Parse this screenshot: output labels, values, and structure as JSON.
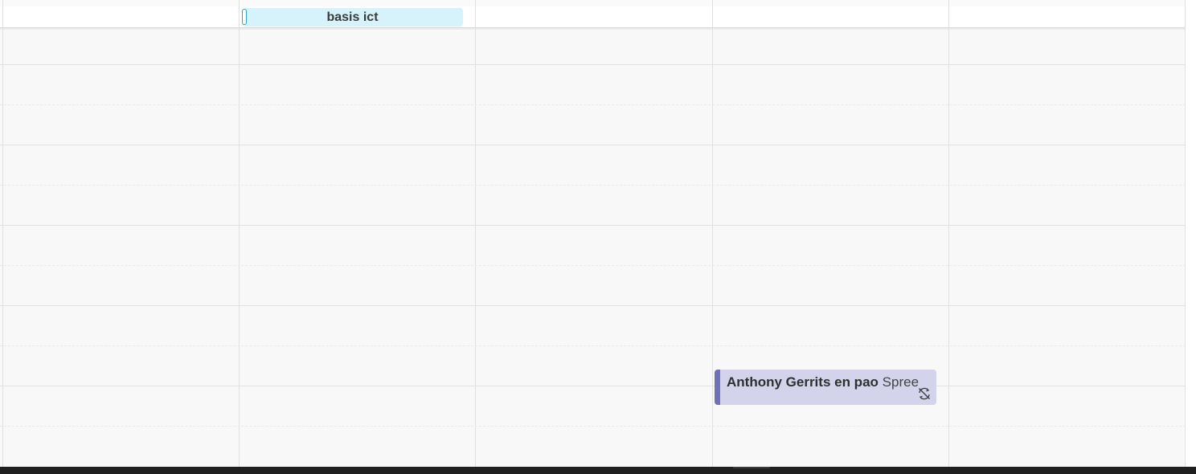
{
  "calendar": {
    "allday_events": [
      {
        "title": "basis ict",
        "color": "#d6f3fb",
        "accent": "#2ea6c8"
      }
    ],
    "events": [
      {
        "name": "Anthony Gerrits en pao",
        "location": "Spree",
        "icon": "recurrence-off-icon",
        "color": "#d3d3ec",
        "accent": "#7072b8"
      }
    ]
  }
}
